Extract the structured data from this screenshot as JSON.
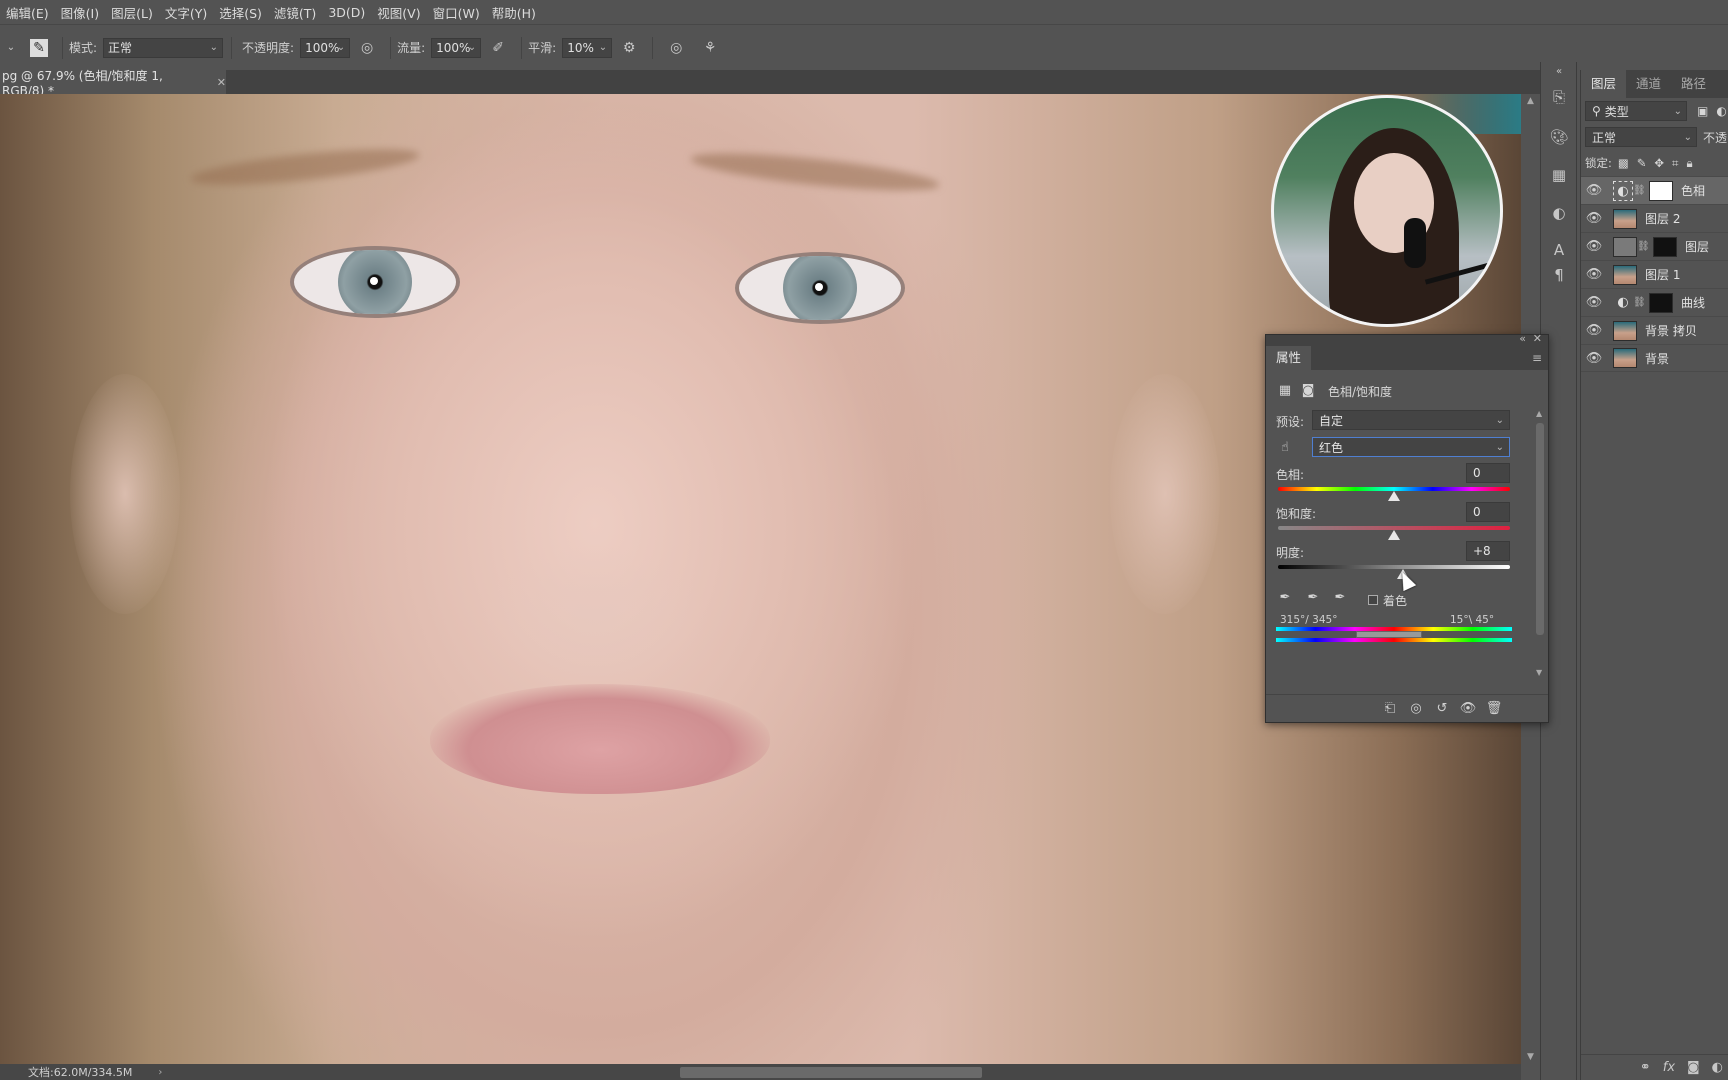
{
  "menu": [
    "编辑(E)",
    "图像(I)",
    "图层(L)",
    "文字(Y)",
    "选择(S)",
    "滤镜(T)",
    "3D(D)",
    "视图(V)",
    "窗口(W)",
    "帮助(H)"
  ],
  "options": {
    "mode_label": "模式:",
    "mode_value": "正常",
    "opacity_label": "不透明度:",
    "opacity_value": "100%",
    "flow_label": "流量:",
    "flow_value": "100%",
    "smooth_label": "平滑:",
    "smooth_value": "10%"
  },
  "document_tab": "pg @ 67.9% (色相/饱和度 1, RGB/8) *",
  "status": "文档:62.0M/334.5M",
  "layers_panel": {
    "tabs": [
      "图层",
      "通道",
      "路径"
    ],
    "filter": "类型",
    "blend": "正常",
    "opacity_partial": "不透",
    "lock_label": "锁定:",
    "layers": [
      {
        "name": "色相",
        "visible": true,
        "selected": true,
        "kind": "adjustment"
      },
      {
        "name": "图层 2",
        "visible": true,
        "kind": "image"
      },
      {
        "name": "图层",
        "visible": true,
        "kind": "masked"
      },
      {
        "name": "图层 1",
        "visible": true,
        "kind": "image"
      },
      {
        "name": "曲线",
        "visible": true,
        "kind": "curves"
      },
      {
        "name": "背景 拷贝",
        "visible": true,
        "kind": "image"
      },
      {
        "name": "背景",
        "visible": true,
        "kind": "image"
      }
    ]
  },
  "properties": {
    "title": "属性",
    "adjustment": "色相/饱和度",
    "preset_label": "预设:",
    "preset_value": "自定",
    "channel_value": "红色",
    "hue_label": "色相:",
    "hue_value": "0",
    "hue_level": 0.5,
    "saturation_label": "饱和度:",
    "saturation_value": "0",
    "saturation_level": 0.5,
    "lightness_label": "明度:",
    "lightness_value": "+8",
    "lightness_level": 0.54,
    "colorize_label": "着色",
    "range_left": "315°/ 345°",
    "range_right": "15°\\ 45°"
  }
}
